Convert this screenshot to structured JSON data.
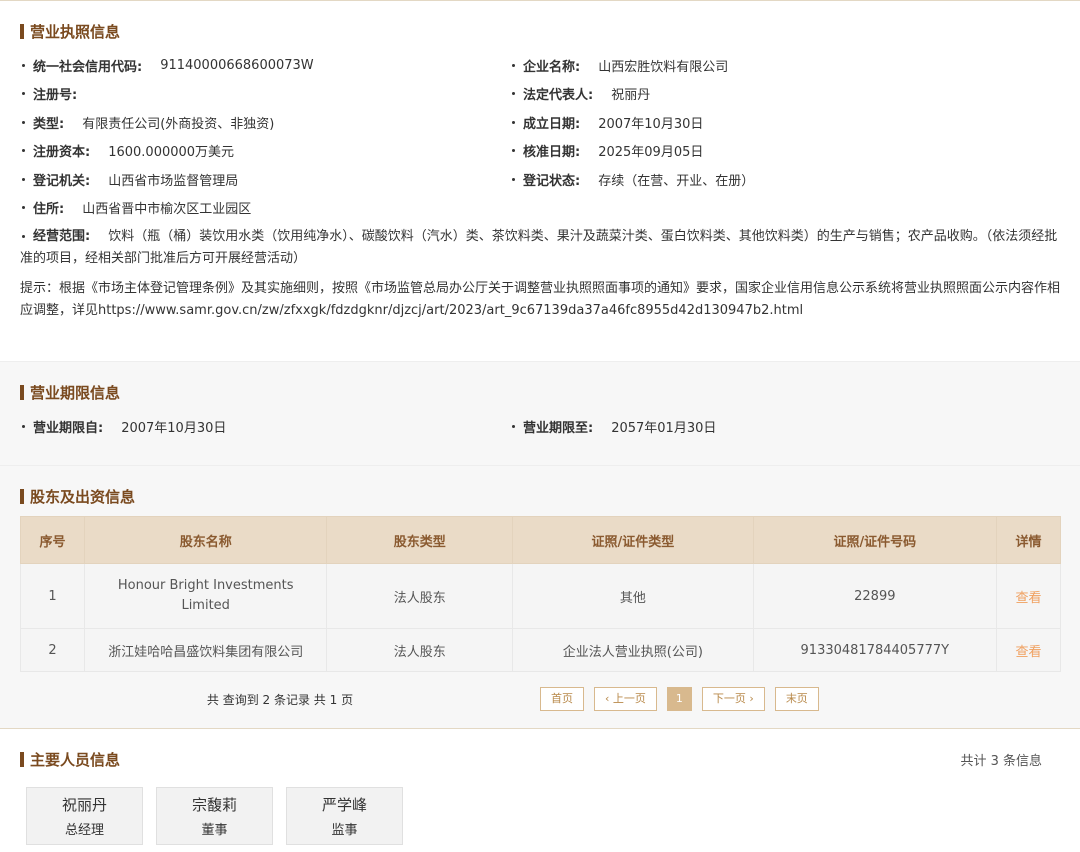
{
  "license": {
    "title": "营业执照信息",
    "fields": {
      "credit_code_label": "统一社会信用代码:",
      "credit_code": "91140000668600073W",
      "company_name_label": "企业名称:",
      "company_name": "山西宏胜饮料有限公司",
      "reg_no_label": "注册号:",
      "reg_no": "",
      "legal_rep_label": "法定代表人:",
      "legal_rep": "祝丽丹",
      "type_label": "类型:",
      "type": "有限责任公司(外商投资、非独资)",
      "founded_label": "成立日期:",
      "founded": "2007年10月30日",
      "capital_label": "注册资本:",
      "capital": "1600.000000万美元",
      "approved_label": "核准日期:",
      "approved": "2025年09月05日",
      "authority_label": "登记机关:",
      "authority": "山西省市场监督管理局",
      "status_label": "登记状态:",
      "status": "存续（在营、开业、在册）",
      "address_label": "住所:",
      "address": "山西省晋中市榆次区工业园区",
      "scope_label": "经营范围:",
      "scope": "饮料（瓶（桶）装饮用水类（饮用纯净水）、碳酸饮料（汽水）类、茶饮料类、果汁及蔬菜汁类、蛋白饮料类、其他饮料类）的生产与销售；农产品收购。（依法须经批准的项目，经相关部门批准后方可开展经营活动）"
    },
    "tip": "提示：根据《市场主体登记管理条例》及其实施细则，按照《市场监管总局办公厅关于调整营业执照照面事项的通知》要求，国家企业信用信息公示系统将营业执照照面公示内容作相应调整，详见https://www.samr.gov.cn/zw/zfxxgk/fdzdgknr/djzcj/art/2023/art_9c67139da37a46fc8955d42d130947b2.html"
  },
  "term": {
    "title": "营业期限信息",
    "from_label": "营业期限自:",
    "from": "2007年10月30日",
    "to_label": "营业期限至:",
    "to": "2057年01月30日"
  },
  "shareholders": {
    "title": "股东及出资信息",
    "headers": [
      "序号",
      "股东名称",
      "股东类型",
      "证照/证件类型",
      "证照/证件号码",
      "详情"
    ],
    "rows": [
      {
        "no": "1",
        "name": "Honour Bright Investments Limited",
        "type": "法人股东",
        "cert_type": "其他",
        "cert_no": "22899",
        "detail": "查看"
      },
      {
        "no": "2",
        "name": "浙江娃哈哈昌盛饮料集团有限公司",
        "type": "法人股东",
        "cert_type": "企业法人营业执照(公司)",
        "cert_no": "91330481784405777Y",
        "detail": "查看"
      }
    ],
    "pager": {
      "info": "共 查询到 2 条记录 共 1 页",
      "first": "首页",
      "prev": "‹ 上一页",
      "current": "1",
      "next": "下一页 ›",
      "last": "末页"
    }
  },
  "personnel": {
    "title": "主要人员信息",
    "total": "共计 3 条信息",
    "people": [
      {
        "name": "祝丽丹",
        "role": "总经理"
      },
      {
        "name": "宗馥莉",
        "role": "董事"
      },
      {
        "name": "严学峰",
        "role": "监事"
      }
    ]
  }
}
